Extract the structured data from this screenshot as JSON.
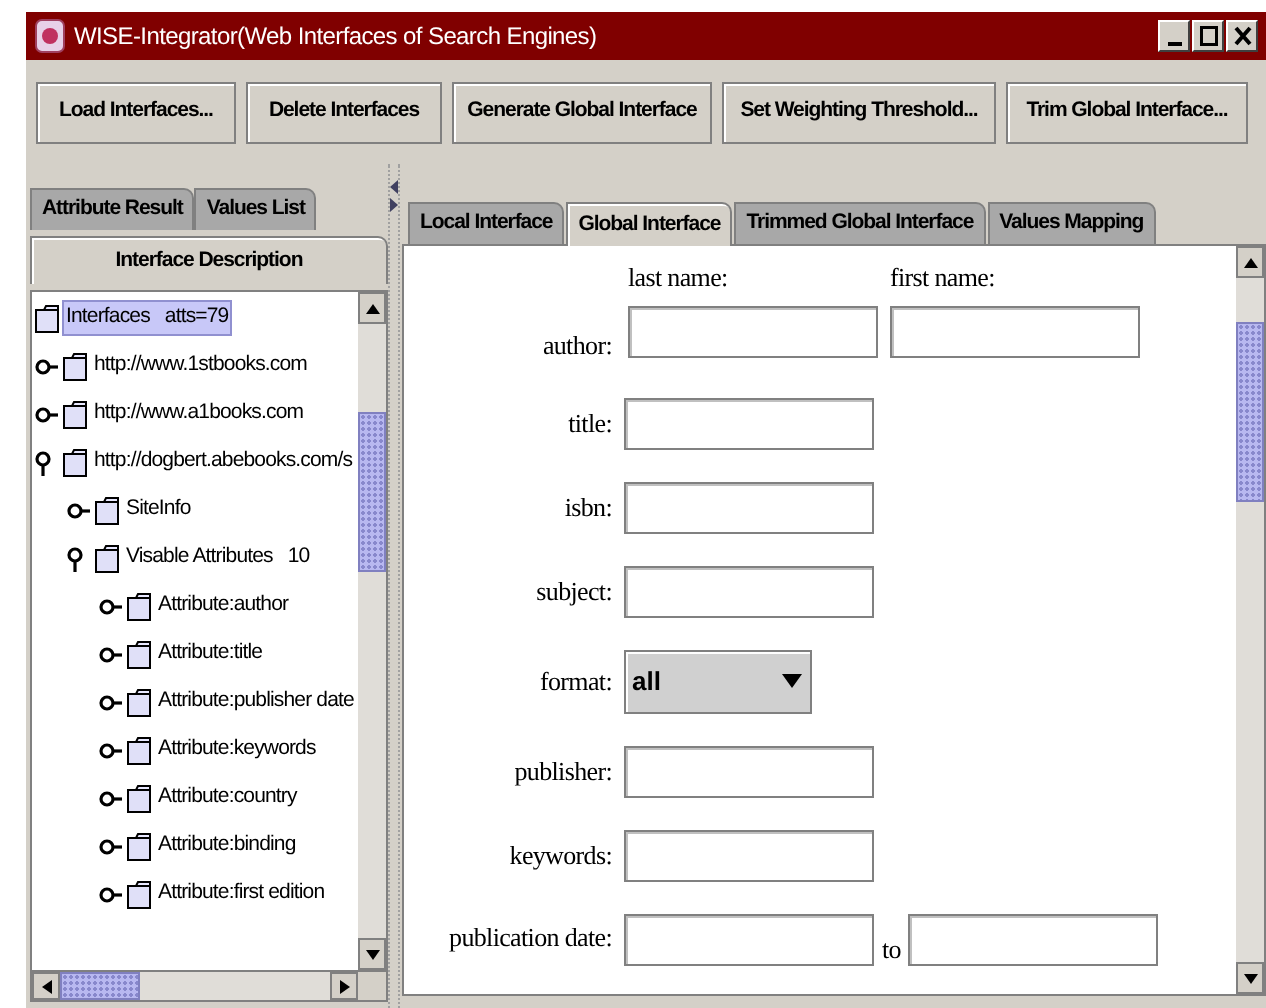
{
  "window": {
    "title": "WISE-Integrator(Web Interfaces of Search Engines)"
  },
  "toolbar": [
    "Load Interfaces...",
    "Delete Interfaces",
    "Generate Global Interface",
    "Set Weighting Threshold...",
    "Trim Global Interface..."
  ],
  "left_panel": {
    "tab_rows": [
      [
        {
          "label": "Attribute Result",
          "selected": false
        },
        {
          "label": "Values List",
          "selected": false
        }
      ],
      [
        {
          "label": "Interface Description",
          "selected": true
        }
      ]
    ],
    "tree": [
      {
        "label": "Interfaces   atts=79",
        "selected": true,
        "children": [
          {
            "label": "http://www.1stbooks.com",
            "selected": false,
            "expanded": false
          },
          {
            "label": "http://www.a1books.com",
            "selected": false,
            "expanded": false
          },
          {
            "label": "http://dogbert.abebooks.com/s",
            "selected": false,
            "expanded": true,
            "children": [
              {
                "label": "SiteInfo",
                "selected": false,
                "expanded": false
              },
              {
                "label": "Visable Attributes   10",
                "selected": false,
                "expanded": true,
                "children": [
                  {
                    "label": "Attribute:author",
                    "selected": false,
                    "expanded": false
                  },
                  {
                    "label": "Attribute:title",
                    "selected": false,
                    "expanded": false
                  },
                  {
                    "label": "Attribute:publisher date",
                    "selected": false,
                    "expanded": false
                  },
                  {
                    "label": "Attribute:keywords",
                    "selected": false,
                    "expanded": false
                  },
                  {
                    "label": "Attribute:country",
                    "selected": false,
                    "expanded": false
                  },
                  {
                    "label": "Attribute:binding",
                    "selected": false,
                    "expanded": false
                  },
                  {
                    "label": "Attribute:first edition",
                    "selected": false,
                    "expanded": false
                  }
                ]
              }
            ]
          }
        ]
      }
    ]
  },
  "right_panel": {
    "tabs": [
      {
        "label": "Local Interface",
        "selected": false
      },
      {
        "label": "Global Interface",
        "selected": true
      },
      {
        "label": "Trimmed Global Interface",
        "selected": false
      },
      {
        "label": "Values Mapping",
        "selected": false
      }
    ],
    "form": [
      {
        "kind": "name_pair",
        "label": "author:",
        "parts": [
          {
            "caption": "last name:"
          },
          {
            "caption": "first name:"
          }
        ]
      },
      {
        "kind": "text",
        "label": "title:"
      },
      {
        "kind": "text",
        "label": "isbn:"
      },
      {
        "kind": "text",
        "label": "subject:"
      },
      {
        "kind": "select",
        "label": "format:",
        "value": "all"
      },
      {
        "kind": "text",
        "label": "publisher:"
      },
      {
        "kind": "text",
        "label": "keywords:"
      },
      {
        "kind": "range",
        "label": "publication date:",
        "joiner": "to"
      }
    ]
  }
}
